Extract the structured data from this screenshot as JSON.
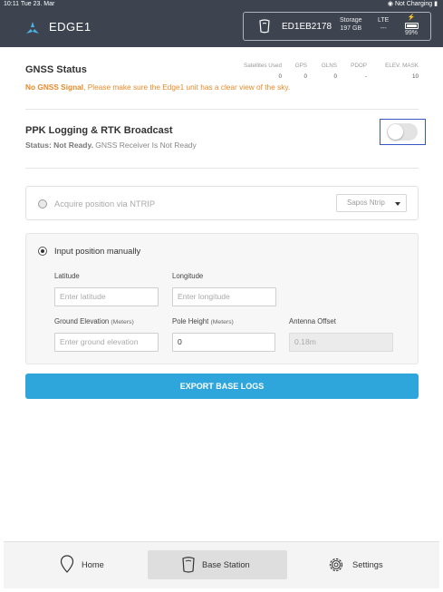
{
  "statusbar": {
    "time_date": "10:11  Tue 23. Mar",
    "right": "Not Charging"
  },
  "header": {
    "app_title": "EDGE1",
    "device_id": "ED1EB2178",
    "storage_label": "Storage",
    "storage_value": "197 GB",
    "lte_label": "LTE",
    "lte_value": "---",
    "battery_value": "99%"
  },
  "gnss": {
    "title": "GNSS Status",
    "message_bold": "No GNSS Signal",
    "message_rest": ", Please make sure the Edge1 unit has a clear view of the sky.",
    "stats": [
      {
        "label": "Satellites Used",
        "value": "0"
      },
      {
        "label": "GPS",
        "value": "0"
      },
      {
        "label": "GLNS",
        "value": "0"
      },
      {
        "label": "PDOP",
        "value": "-"
      },
      {
        "label": "ELEV. MASK",
        "value": "10"
      }
    ]
  },
  "ppk": {
    "title": "PPK Logging & RTK Broadcast",
    "status_bold": "Status: Not Ready.",
    "status_rest": " GNSS Receiver Is Not Ready",
    "toggle_on": false
  },
  "ntrip": {
    "label": "Acquire position via NTRIP",
    "select_value": "Sapos Ntrip"
  },
  "manual": {
    "label": "Input position manually",
    "latitude_label": "Latitude",
    "latitude_placeholder": "Enter latitude",
    "longitude_label": "Longitude",
    "longitude_placeholder": "Enter longitude",
    "ground_label": "Ground Elevation",
    "ground_unit": "(Meters)",
    "ground_placeholder": "Enter ground elevation",
    "pole_label": "Pole Height",
    "pole_unit": "(Meters)",
    "pole_value": "0",
    "antenna_label": "Antenna Offset",
    "antenna_value": "0.18m"
  },
  "export_button": "EXPORT BASE LOGS",
  "tabs": [
    {
      "label": "Home",
      "icon": "map-pin-icon"
    },
    {
      "label": "Base Station",
      "icon": "base-station-icon",
      "active": true
    },
    {
      "label": "Settings",
      "icon": "gear-icon"
    }
  ],
  "colors": {
    "header_bg": "#3d4450",
    "warning": "#e8892a",
    "primary_button": "#2ea6dc",
    "focus_outline": "#3556c4"
  }
}
